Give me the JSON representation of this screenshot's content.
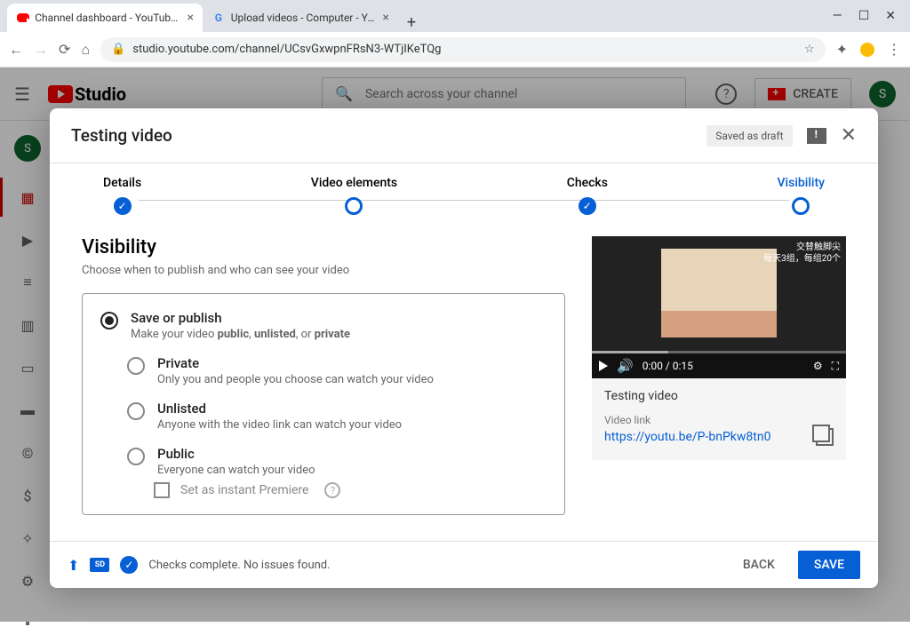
{
  "browser": {
    "tabs": [
      {
        "title": "Channel dashboard - YouTube St"
      },
      {
        "title": "Upload videos - Computer - You"
      }
    ],
    "url": "studio.youtube.com/channel/UCsvGxwpnFRsN3-WTjIKeTQg"
  },
  "header": {
    "logo_text": "Studio",
    "search_placeholder": "Search across your channel",
    "create_label": "CREATE",
    "avatar_initial": "S"
  },
  "sidebar": {
    "avatar_initial": "S"
  },
  "dialog": {
    "title": "Testing video",
    "draft_badge": "Saved as draft",
    "steps": {
      "details": "Details",
      "elements": "Video elements",
      "checks": "Checks",
      "visibility": "Visibility"
    },
    "visibility": {
      "heading": "Visibility",
      "subtitle": "Choose when to publish and who can see your video",
      "save_publish": {
        "title": "Save or publish",
        "desc_pre": "Make your video ",
        "desc_b1": "public",
        "desc_m1": ", ",
        "desc_b2": "unlisted",
        "desc_m2": ", or ",
        "desc_b3": "private"
      },
      "private": {
        "title": "Private",
        "desc": "Only you and people you choose can watch your video"
      },
      "unlisted": {
        "title": "Unlisted",
        "desc": "Anyone with the video link can watch your video"
      },
      "public": {
        "title": "Public",
        "desc": "Everyone can watch your video"
      },
      "premiere_label": "Set as instant Premiere"
    },
    "preview": {
      "caption1": "交替触脚尖",
      "caption2": "每天3组，每组20个",
      "time": "0:00 / 0:15",
      "video_title": "Testing video",
      "link_label": "Video link",
      "link": "https://youtu.be/P-bnPkw8tn0"
    },
    "footer": {
      "hd_label": "SD",
      "checks_text": "Checks complete. No issues found.",
      "back": "BACK",
      "save": "SAVE"
    }
  }
}
